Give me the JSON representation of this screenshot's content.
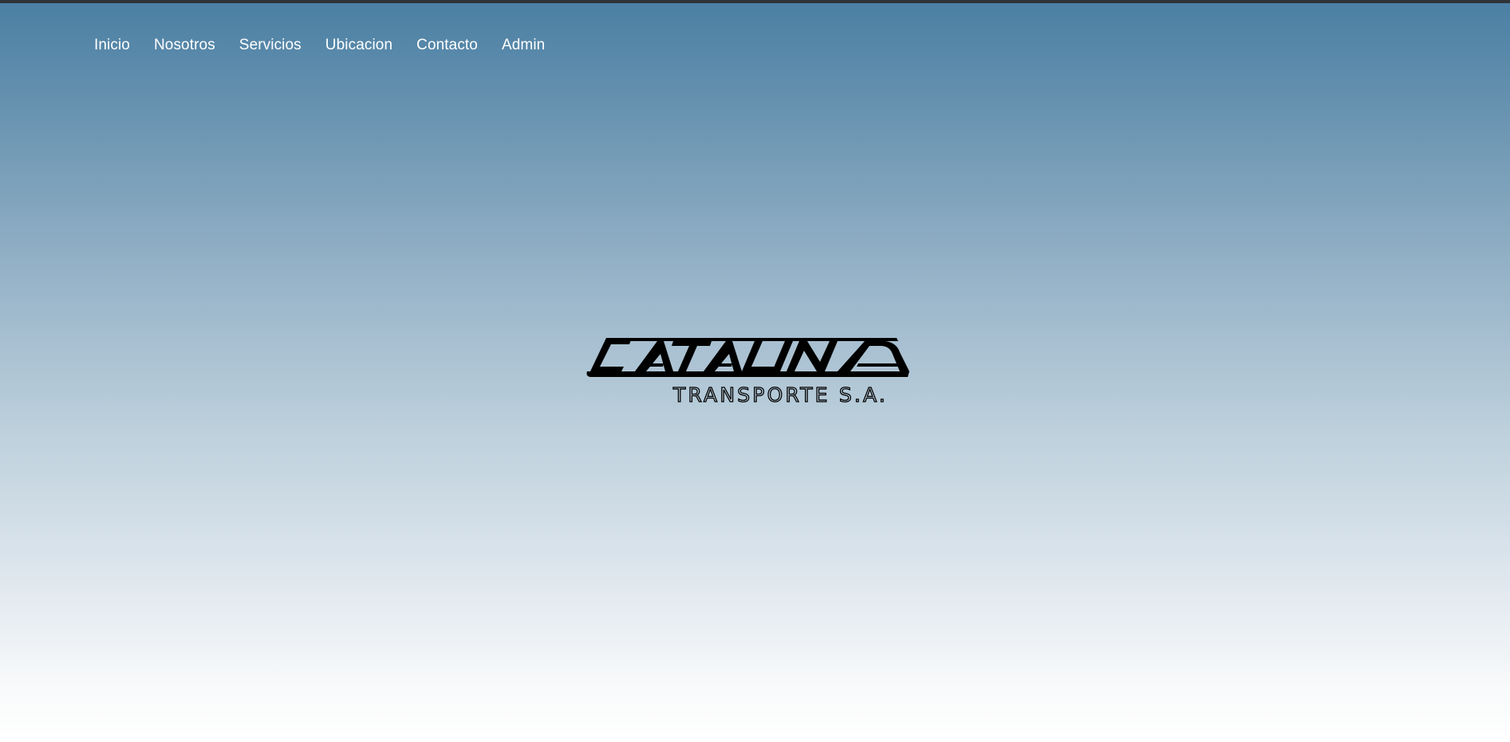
{
  "nav": {
    "items": [
      {
        "label": "Inicio"
      },
      {
        "label": "Nosotros"
      },
      {
        "label": "Servicios"
      },
      {
        "label": "Ubicacion"
      },
      {
        "label": "Contacto"
      },
      {
        "label": "Admin"
      }
    ]
  },
  "logo": {
    "name": "CATALINA",
    "subtitle": "TRANSPORTE S.A."
  },
  "colors": {
    "gradient_top": "#4a7fa3",
    "gradient_bottom": "#ffffff",
    "nav_text": "#ffffff",
    "logo": "#000000"
  }
}
